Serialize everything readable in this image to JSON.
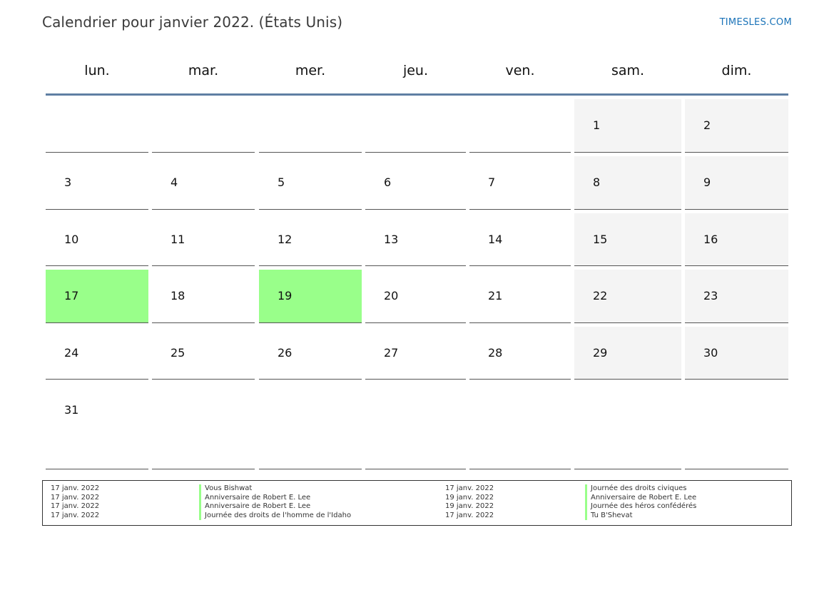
{
  "title": "Calendrier pour janvier 2022. (États Unis)",
  "brand": "TIMESLES.COM",
  "colors": {
    "holiday": "#99ff8a",
    "weekend": "#f4f4f4",
    "header_rule": "#5f7fa3",
    "brand": "#1a73b8"
  },
  "weekdays": [
    "lun.",
    "mar.",
    "mer.",
    "jeu.",
    "ven.",
    "sam.",
    "dim."
  ],
  "weeks": [
    [
      "",
      "",
      "",
      "",
      "",
      "1",
      "2"
    ],
    [
      "3",
      "4",
      "5",
      "6",
      "7",
      "8",
      "9"
    ],
    [
      "10",
      "11",
      "12",
      "13",
      "14",
      "15",
      "16"
    ],
    [
      "17",
      "18",
      "19",
      "20",
      "21",
      "22",
      "23"
    ],
    [
      "24",
      "25",
      "26",
      "27",
      "28",
      "29",
      "30"
    ],
    [
      "31",
      "",
      "",
      "",
      "",
      "",
      ""
    ]
  ],
  "highlighted_days": [
    "17",
    "19"
  ],
  "legend": {
    "left": [
      {
        "date": "17 janv. 2022",
        "event": "Vous Bishwat"
      },
      {
        "date": "17 janv. 2022",
        "event": "Anniversaire de Robert E. Lee"
      },
      {
        "date": "17 janv. 2022",
        "event": "Anniversaire de Robert E. Lee"
      },
      {
        "date": "17 janv. 2022",
        "event": "Journée des droits de l'homme de l'Idaho"
      }
    ],
    "right": [
      {
        "date": "17 janv. 2022",
        "event": "Journée des droits civiques"
      },
      {
        "date": "19 janv. 2022",
        "event": "Anniversaire de Robert E. Lee"
      },
      {
        "date": "19 janv. 2022",
        "event": "Journée des héros confédérés"
      },
      {
        "date": "17 janv. 2022",
        "event": "Tu B'Shevat"
      }
    ]
  }
}
